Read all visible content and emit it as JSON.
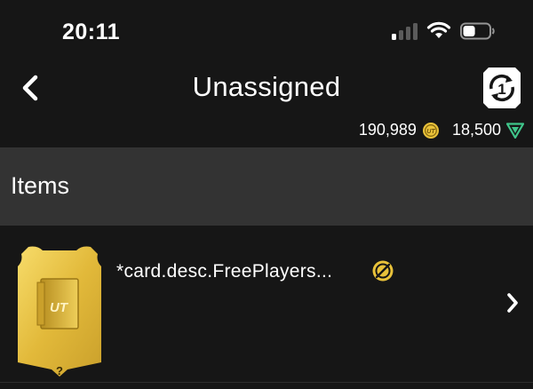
{
  "status_bar": {
    "time": "20:11",
    "signal_bars_active": 1,
    "signal_bars_total": 4,
    "battery_level": 0.45
  },
  "nav": {
    "title": "Unassigned",
    "back_icon": "chevron-left-icon",
    "action_icon": "ut-swap-icon"
  },
  "currency": {
    "coins": "190,989",
    "coins_icon": "coin-icon",
    "points": "18,500",
    "points_icon": "fifa-points-icon"
  },
  "section": {
    "title": "Items"
  },
  "items": [
    {
      "description": "*card.desc.FreePlayers...",
      "card_label": "UT",
      "card_footer": "?",
      "badge_icon": "untradeable-icon",
      "chevron_icon": "chevron-right-icon"
    }
  ],
  "colors": {
    "background": "#161616",
    "section_header": "#333333",
    "gold": "#e9c23a",
    "points_green": "#3fc58a"
  }
}
